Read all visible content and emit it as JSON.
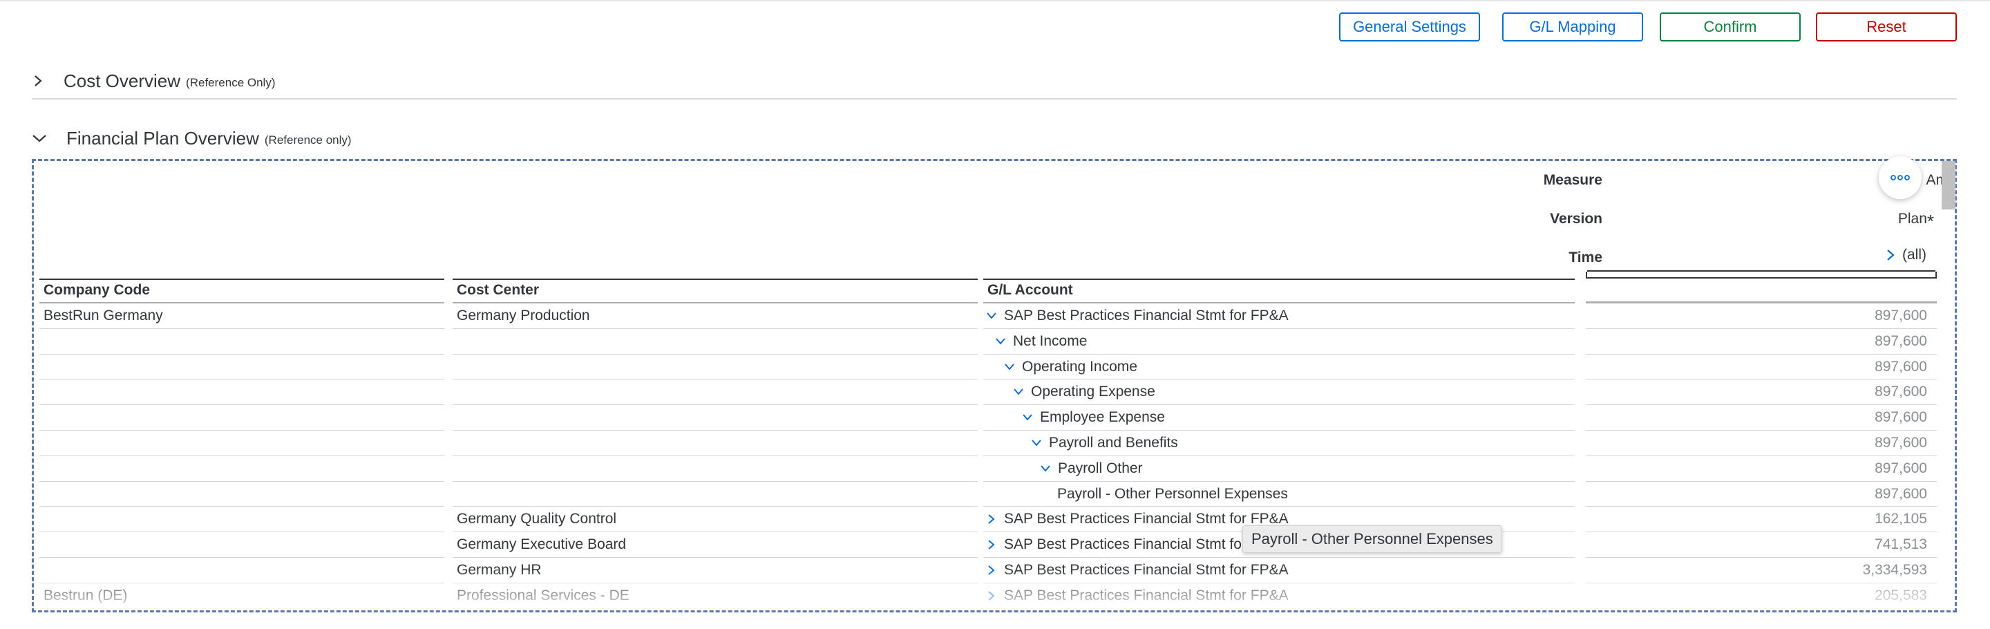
{
  "header": {
    "buttons": {
      "general_settings": "General Settings",
      "gl_mapping": "G/L Mapping",
      "confirm": "Confirm",
      "reset": "Reset"
    }
  },
  "sections": {
    "cost_overview": {
      "title": "Cost Overview",
      "subtitle": "(Reference Only)",
      "expanded": false
    },
    "financial_plan": {
      "title": "Financial Plan Overview",
      "subtitle": "(Reference only)",
      "expanded": true
    }
  },
  "table": {
    "meta": {
      "measure_label": "Measure",
      "measure_value": "Am",
      "version_label": "Version",
      "version_value": "Plan",
      "version_marker": "*",
      "time_label": "Time",
      "time_value": "(all)"
    },
    "columns": {
      "company_code": "Company Code",
      "cost_center": "Cost Center",
      "gl_account": "G/L Account"
    },
    "rows": [
      {
        "company": "BestRun Germany",
        "cost_center": "Germany Production",
        "gl": "SAP Best Practices Financial Stmt for FP&A",
        "chev": "down",
        "value": "897,600"
      },
      {
        "company": "",
        "cost_center": "",
        "gl": "Net Income",
        "chev": "down",
        "value": "897,600"
      },
      {
        "company": "",
        "cost_center": "",
        "gl": "Operating Income",
        "chev": "down",
        "value": "897,600"
      },
      {
        "company": "",
        "cost_center": "",
        "gl": "Operating Expense",
        "chev": "down",
        "value": "897,600"
      },
      {
        "company": "",
        "cost_center": "",
        "gl": "Employee Expense",
        "chev": "down",
        "value": "897,600"
      },
      {
        "company": "",
        "cost_center": "",
        "gl": "Payroll and Benefits",
        "chev": "down",
        "value": "897,600"
      },
      {
        "company": "",
        "cost_center": "",
        "gl": "Payroll Other",
        "chev": "down",
        "value": "897,600"
      },
      {
        "company": "",
        "cost_center": "",
        "gl": "Payroll - Other Personnel Expenses",
        "chev": "none",
        "value": "897,600"
      },
      {
        "company": "",
        "cost_center": "Germany Quality Control",
        "gl": "SAP Best Practices Financial Stmt for FP&A",
        "chev": "right",
        "value": "162,105"
      },
      {
        "company": "",
        "cost_center": "Germany Executive Board",
        "gl": "SAP Best Practices Financial Stmt for",
        "chev": "right",
        "value": "741,513"
      },
      {
        "company": "",
        "cost_center": "Germany HR",
        "gl": "SAP Best Practices Financial Stmt for FP&A",
        "chev": "right",
        "value": "3,334,593"
      },
      {
        "company": "Bestrun (DE)",
        "cost_center": "Professional Services - DE",
        "gl": "SAP Best Practices Financial Stmt for FP&A",
        "chev": "right",
        "value": "205,583"
      }
    ]
  },
  "tooltip": {
    "text": "Payroll - Other Personnel Expenses"
  },
  "icons": {
    "more": "more-horizontal-icon",
    "expand": "chevron-right-icon",
    "collapse": "chevron-down-icon"
  },
  "colors": {
    "primary": "#0a6ed1",
    "positive": "#107e3e",
    "negative": "#bb0000",
    "text": "#32363a",
    "muted_value": "#8a8e93"
  }
}
